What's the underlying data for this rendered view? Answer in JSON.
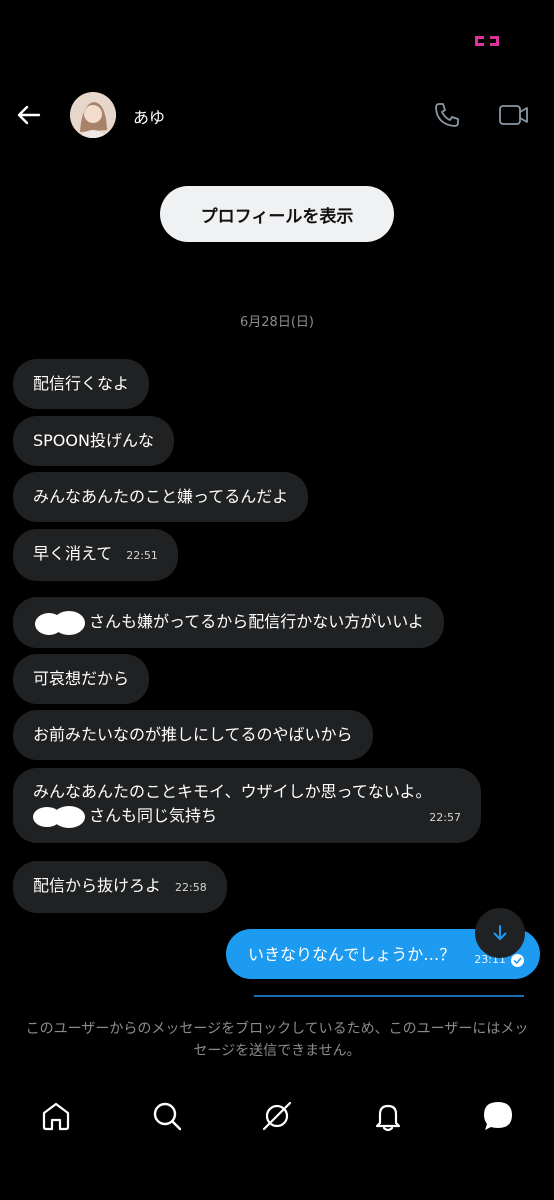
{
  "header": {
    "name": "あゆ"
  },
  "profile_button_label": "プロフィールを表示",
  "date_separator": "6月28日(日)",
  "messages": [
    {
      "text": "配信行くなよ",
      "time": ""
    },
    {
      "text": "SPOON投げんな",
      "time": ""
    },
    {
      "text": "みんなあんたのこと嫌ってるんだよ",
      "time": ""
    },
    {
      "text": "早く消えて",
      "time": "22:51"
    },
    {
      "text": "さんも嫌がってるから配信行かない方がいいよ",
      "time": ""
    },
    {
      "text": "可哀想だから",
      "time": ""
    },
    {
      "text": "お前みたいなのが推しにしてるのやばいから",
      "time": ""
    },
    {
      "line1": "みんなあんたのことキモイ、ウザイしか思ってないよ。",
      "line2": "さんも同じ気持ち",
      "time": "22:57"
    },
    {
      "text": "配信から抜けろよ",
      "time": "22:58"
    }
  ],
  "outgoing": {
    "text": "いきなりなんでしょうか…？",
    "time": "23:11"
  },
  "blocked_notice": "このユーザーからのメッセージをブロックしているため、このユーザーにはメッセージを送信できません。",
  "tabs": [
    "home-icon",
    "search-icon",
    "spaces-icon",
    "notifications-icon",
    "messages-icon"
  ],
  "colors": {
    "accent": "#1d9bf0",
    "bubble": "#1f2123",
    "background": "#000000"
  }
}
